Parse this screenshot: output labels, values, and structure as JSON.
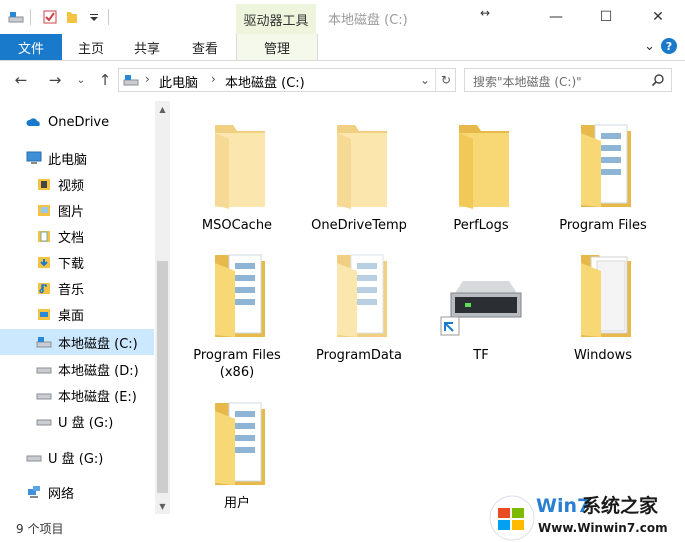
{
  "window": {
    "title": "本地磁盘 (C:)",
    "context_tab": "驱动器工具",
    "controls": {
      "minimize": "—",
      "maximize": "☐",
      "close": "✕"
    }
  },
  "ribbon": {
    "file": "文件",
    "tabs": [
      "主页",
      "共享",
      "查看"
    ],
    "manage": "管理"
  },
  "nav": {
    "breadcrumbs": [
      "此电脑",
      "本地磁盘 (C:)"
    ],
    "search_placeholder": "搜索\"本地磁盘 (C:)\""
  },
  "sidebar": {
    "items": [
      {
        "label": "OneDrive",
        "icon": "onedrive-icon"
      },
      {
        "label": "此电脑",
        "icon": "computer-icon"
      },
      {
        "label": "视频",
        "icon": "videos-folder-icon"
      },
      {
        "label": "图片",
        "icon": "pictures-folder-icon"
      },
      {
        "label": "文档",
        "icon": "documents-folder-icon"
      },
      {
        "label": "下载",
        "icon": "downloads-folder-icon"
      },
      {
        "label": "音乐",
        "icon": "music-folder-icon"
      },
      {
        "label": "桌面",
        "icon": "desktop-folder-icon"
      },
      {
        "label": "本地磁盘 (C:)",
        "icon": "system-drive-icon"
      },
      {
        "label": "本地磁盘 (D:)",
        "icon": "drive-icon"
      },
      {
        "label": "本地磁盘 (E:)",
        "icon": "drive-icon"
      },
      {
        "label": "U 盘 (G:)",
        "icon": "usb-drive-icon"
      },
      {
        "label": "U 盘 (G:)",
        "icon": "usb-drive-icon"
      },
      {
        "label": "网络",
        "icon": "network-icon"
      }
    ]
  },
  "content": {
    "items": [
      {
        "label": "MSOCache",
        "type": "empty-folder"
      },
      {
        "label": "OneDriveTemp",
        "type": "empty-folder"
      },
      {
        "label": "PerfLogs",
        "type": "empty-folder-solid"
      },
      {
        "label": "Program Files",
        "type": "folder-with-files"
      },
      {
        "label": "Program Files\n(x86)",
        "type": "folder-with-files"
      },
      {
        "label": "ProgramData",
        "type": "folder-with-files-light"
      },
      {
        "label": "TF",
        "type": "drive-shortcut"
      },
      {
        "label": "Windows",
        "type": "folder-with-white-files"
      },
      {
        "label": "用户",
        "type": "folder-with-files"
      }
    ]
  },
  "status": {
    "count": "9 个项目"
  },
  "watermark": {
    "brand_win": "Win7",
    "brand_cn": "系统之家",
    "url": "Www.Winwin7.com"
  },
  "colors": {
    "accent": "#1979ca",
    "selection": "#cce8ff",
    "folder": "#f8d775"
  }
}
